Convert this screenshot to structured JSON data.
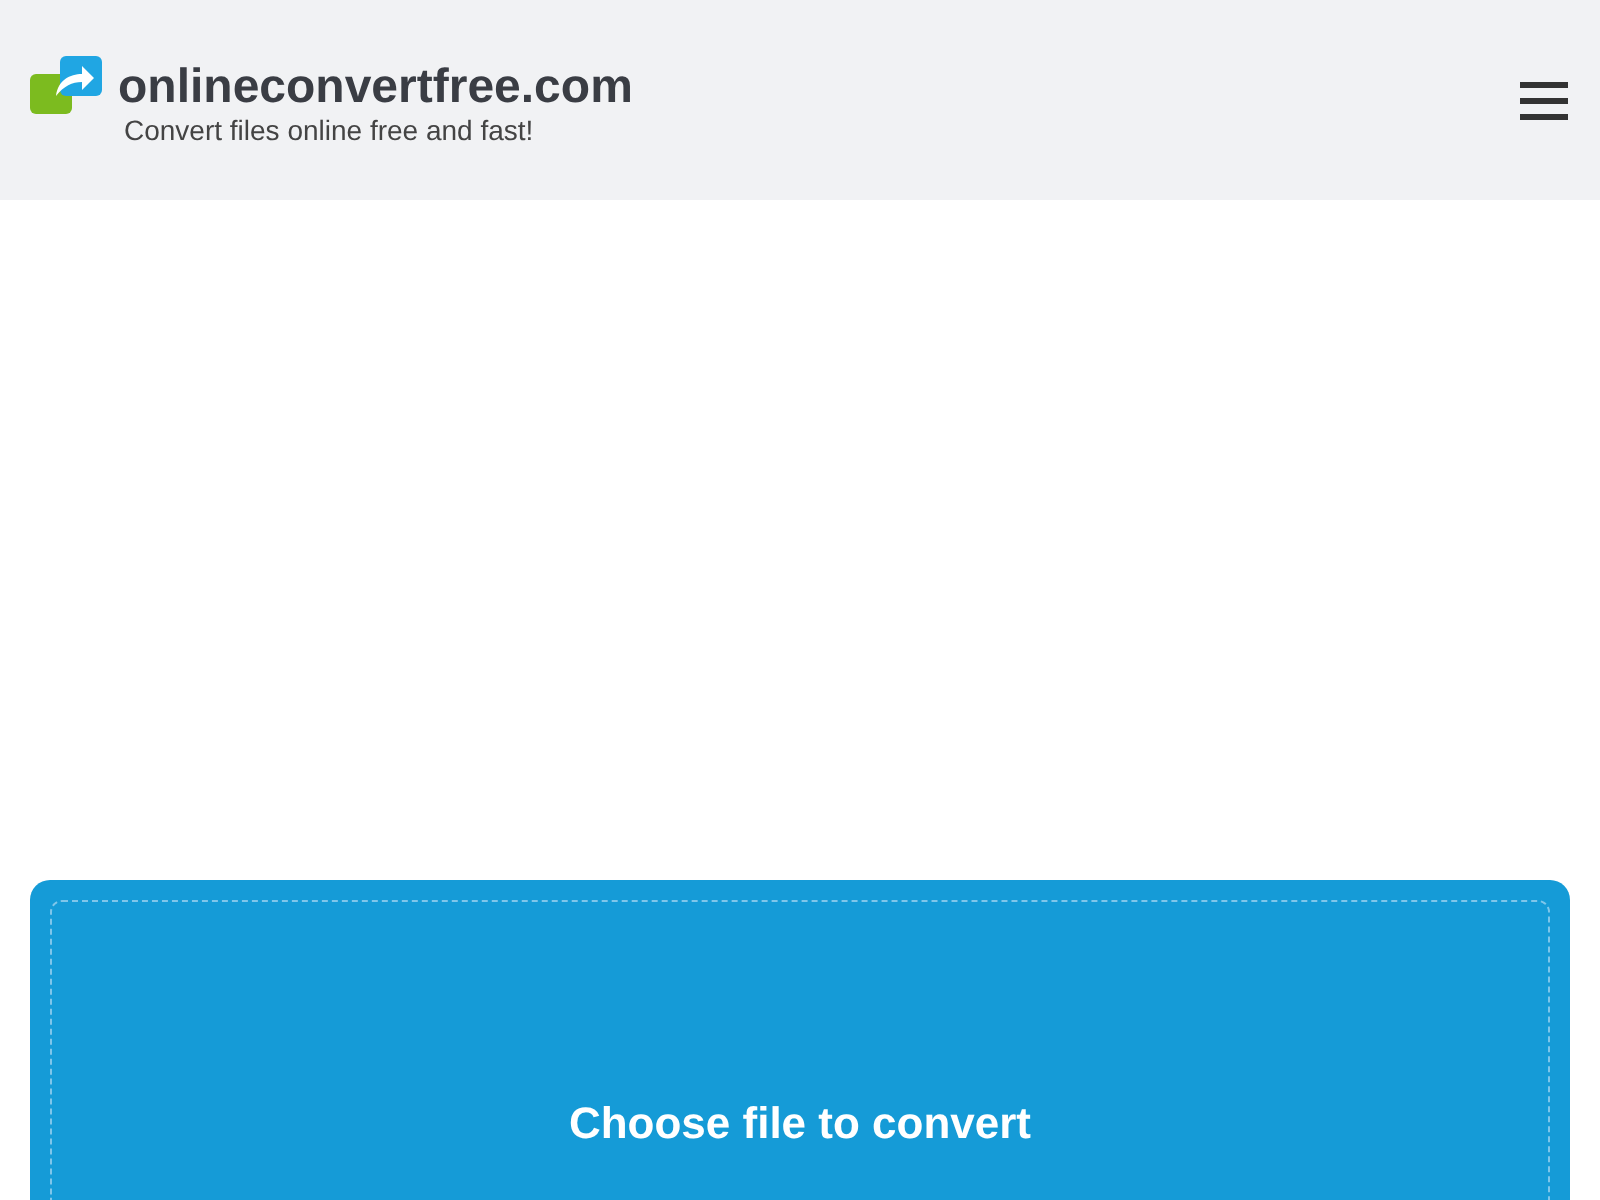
{
  "header": {
    "site_name": "onlineconvertfree.com",
    "tagline": "Convert files online free and fast!"
  },
  "upload": {
    "label": "Choose file to convert"
  }
}
